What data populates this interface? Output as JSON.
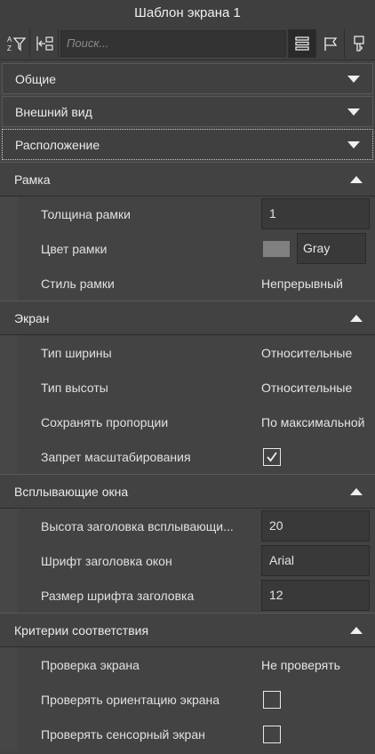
{
  "window": {
    "title": "Шаблон экрана 1"
  },
  "toolbar": {
    "search_placeholder": "Поиск...",
    "icons": [
      "sort-az-filter-icon",
      "collapse-expand-icon",
      "list-view-icon",
      "flag-icon",
      "key-icon"
    ]
  },
  "sections": {
    "general": {
      "label": "Общие",
      "state": "collapsed"
    },
    "appearance": {
      "label": "Внешний вид",
      "state": "collapsed"
    },
    "location": {
      "label": "Расположение",
      "state": "collapsed"
    },
    "frame": {
      "label": "Рамка",
      "rows": {
        "thickness": {
          "label": "Толщина рамки",
          "value": "1"
        },
        "color": {
          "label": "Цвет рамки",
          "value": "Gray",
          "swatch": "#808080"
        },
        "style": {
          "label": "Стиль рамки",
          "value": "Непрерывный"
        }
      }
    },
    "screen": {
      "label": "Экран",
      "rows": {
        "width_type": {
          "label": "Тип ширины",
          "value": "Относительные"
        },
        "height_type": {
          "label": "Тип высоты",
          "value": "Относительные"
        },
        "keep_proportions": {
          "label": "Сохранять пропорции",
          "value": "По максимальной"
        },
        "scale_forbid": {
          "label": "Запрет масштабирования",
          "checked": true
        }
      }
    },
    "popups": {
      "label": "Всплывающие окна",
      "rows": {
        "header_height": {
          "label": "Высота заголовка всплывающи...",
          "value": "20"
        },
        "header_font": {
          "label": "Шрифт заголовка окон",
          "value": "Arial"
        },
        "header_font_size": {
          "label": "Размер шрифта заголовка",
          "value": "12"
        }
      }
    },
    "criteria": {
      "label": "Критерии соответствия",
      "rows": {
        "screen_check": {
          "label": "Проверка экрана",
          "value": "Не проверять"
        },
        "orientation_check": {
          "label": "Проверять ориентацию экрана",
          "checked": false
        },
        "touch_check": {
          "label": "Проверять сенсорный экран",
          "checked": false
        }
      }
    }
  },
  "colors": {
    "background": "#434343",
    "header": "#424242",
    "border": "#2c2c2c"
  }
}
